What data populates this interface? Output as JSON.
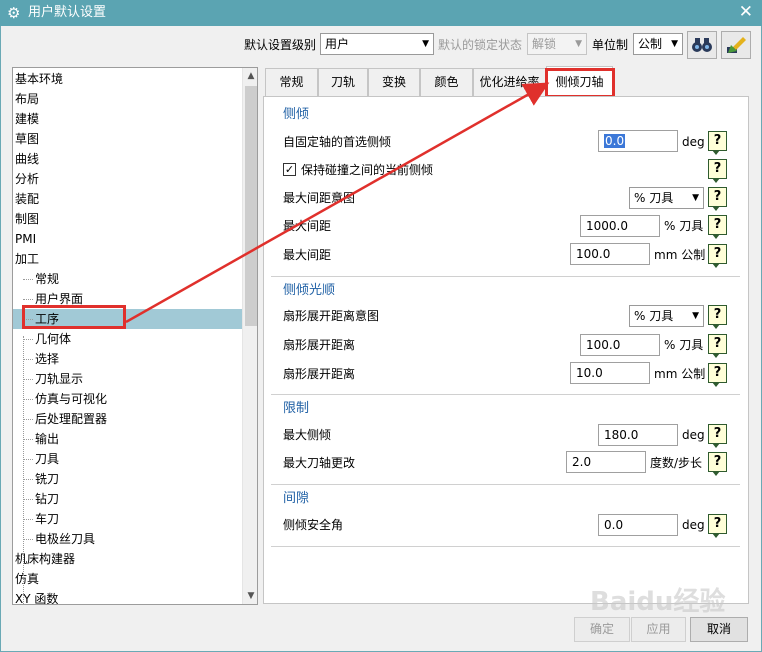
{
  "window": {
    "title": "用户默认设置",
    "close_glyph": "✕"
  },
  "toolbar": {
    "level_label": "默认设置级别",
    "level_value": "用户",
    "lock_label": "默认的锁定状态",
    "lock_value": "解锁",
    "unit_label": "单位制",
    "unit_value": "公制",
    "icons": [
      "binoculars-icon",
      "pen-settings-icon"
    ]
  },
  "tree": {
    "items": [
      {
        "label": "基本环境",
        "level": 0
      },
      {
        "label": "布局",
        "level": 0
      },
      {
        "label": "建模",
        "level": 0
      },
      {
        "label": "草图",
        "level": 0
      },
      {
        "label": "曲线",
        "level": 0
      },
      {
        "label": "分析",
        "level": 0
      },
      {
        "label": "装配",
        "level": 0
      },
      {
        "label": "制图",
        "level": 0
      },
      {
        "label": "PMI",
        "level": 0
      },
      {
        "label": "加工",
        "level": 0
      },
      {
        "label": "常规",
        "level": 1
      },
      {
        "label": "用户界面",
        "level": 1
      },
      {
        "label": "工序",
        "level": 1,
        "selected": true
      },
      {
        "label": "几何体",
        "level": 1
      },
      {
        "label": "选择",
        "level": 1
      },
      {
        "label": "刀轨显示",
        "level": 1
      },
      {
        "label": "仿真与可视化",
        "level": 1
      },
      {
        "label": "后处理配置器",
        "level": 1
      },
      {
        "label": "输出",
        "level": 1
      },
      {
        "label": "刀具",
        "level": 1
      },
      {
        "label": "铣刀",
        "level": 1
      },
      {
        "label": "钻刀",
        "level": 1
      },
      {
        "label": "车刀",
        "level": 1
      },
      {
        "label": "电极丝刀具",
        "level": 1
      },
      {
        "label": "机床构建器",
        "level": 0
      },
      {
        "label": "仿真",
        "level": 0
      },
      {
        "label": "XY 函数",
        "level": 0
      }
    ]
  },
  "tabs": [
    "常规",
    "刀轨",
    "变换",
    "颜色",
    "优化进给率",
    "侧倾刀轴"
  ],
  "active_tab": "侧倾刀轴",
  "groups": {
    "tilt": {
      "title": "侧倾",
      "first_tilt_label": "自固定轴的首选侧倾",
      "first_tilt_value": "0.0",
      "first_tilt_unit": "deg",
      "keep_tilt_label": "保持碰撞之间的当前侧倾",
      "keep_tilt_checked": true,
      "max_dist_intent_label": "最大间距意图",
      "max_dist_intent_value": "% 刀具",
      "max_dist1_label": "最大间距",
      "max_dist1_value": "1000.0",
      "max_dist1_unit": "% 刀具",
      "max_dist2_label": "最大间距",
      "max_dist2_value": "100.0",
      "max_dist2_unit": "mm 公制"
    },
    "smooth": {
      "title": "侧倾光顺",
      "fan_intent_label": "扇形展开距离意图",
      "fan_intent_value": "% 刀具",
      "fan1_label": "扇形展开距离",
      "fan1_value": "100.0",
      "fan1_unit": "% 刀具",
      "fan2_label": "扇形展开距离",
      "fan2_value": "10.0",
      "fan2_unit": "mm 公制"
    },
    "limits": {
      "title": "限制",
      "max_tilt_label": "最大侧倾",
      "max_tilt_value": "180.0",
      "max_tilt_unit": "deg",
      "max_axis_label": "最大刀轴更改",
      "max_axis_value": "2.0",
      "max_axis_unit": "度数/步长"
    },
    "clearance": {
      "title": "间隙",
      "safe_angle_label": "侧倾安全角",
      "safe_angle_value": "0.0",
      "safe_angle_unit": "deg"
    }
  },
  "help_glyph": "?",
  "buttons": {
    "ok": "确定",
    "apply": "应用",
    "cancel": "取消"
  },
  "annotation_color": "#e0302c",
  "watermark": "Baidu经验"
}
